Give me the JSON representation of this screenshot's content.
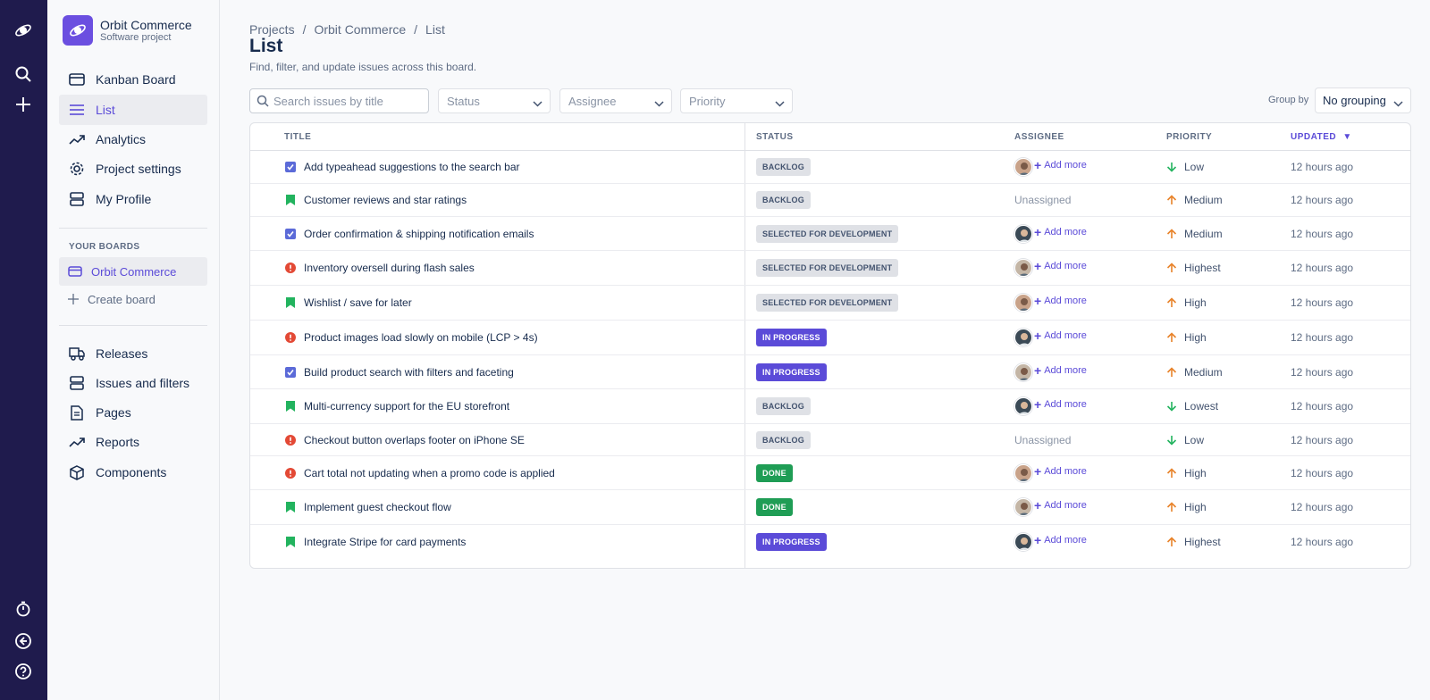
{
  "colors": {
    "rail": "#1f1b4d",
    "accent": "#5b4bd8",
    "done": "#1f9d55",
    "bug": "#e34935",
    "story": "#22b35e",
    "task": "#5b6ad8",
    "priority_up": "#e8832a",
    "priority_down": "#22b35e"
  },
  "rail": {
    "icons": [
      "orbit-logo-icon",
      "search-icon",
      "plus-icon",
      "timer-icon",
      "back-icon",
      "help-icon"
    ]
  },
  "project": {
    "name": "Orbit Commerce",
    "type": "Software project"
  },
  "sidebar": {
    "nav": [
      {
        "label": "Kanban Board",
        "icon": "board-icon"
      },
      {
        "label": "List",
        "icon": "list-icon"
      },
      {
        "label": "Analytics",
        "icon": "trend-icon"
      },
      {
        "label": "Project settings",
        "icon": "gear-icon"
      },
      {
        "label": "My Profile",
        "icon": "profile-icon"
      }
    ],
    "boards_label": "YOUR BOARDS",
    "board": "Orbit Commerce",
    "create_board": "Create board",
    "nav2": [
      {
        "label": "Releases",
        "icon": "truck-icon"
      },
      {
        "label": "Issues and filters",
        "icon": "filter-icon"
      },
      {
        "label": "Pages",
        "icon": "page-icon"
      },
      {
        "label": "Reports",
        "icon": "reports-icon"
      },
      {
        "label": "Components",
        "icon": "component-icon"
      }
    ]
  },
  "breadcrumb": [
    "Projects",
    "Orbit Commerce",
    "List"
  ],
  "page": {
    "title": "List",
    "subtitle": "Find, filter, and update issues across this board."
  },
  "filters": {
    "search_placeholder": "Search issues by title",
    "status": "Status",
    "assignee": "Assignee",
    "priority": "Priority",
    "group_by_label": "Group by",
    "group_by_value": "No grouping"
  },
  "table": {
    "headers": {
      "title": "TITLE",
      "status": "STATUS",
      "assignee": "ASSIGNEE",
      "priority": "PRIORITY",
      "updated": "UPDATED"
    },
    "sort_indicator": "▼",
    "add_more": "Add more",
    "rows": [
      {
        "type": "task",
        "title": "Add typeahead suggestions to the search bar",
        "status": "BACKLOG",
        "status_style": "gray",
        "assignee": "avatar",
        "avatar_variant": "a",
        "priority": "Low",
        "priority_dir": "down",
        "updated": "12 hours ago"
      },
      {
        "type": "story",
        "title": "Customer reviews and star ratings",
        "status": "BACKLOG",
        "status_style": "gray",
        "assignee": "none",
        "unassigned": "Unassigned",
        "priority": "Medium",
        "priority_dir": "up",
        "updated": "12 hours ago"
      },
      {
        "type": "task",
        "title": "Order confirmation & shipping notification emails",
        "status": "SELECTED FOR DEVELOPMENT",
        "status_style": "gray",
        "assignee": "avatar",
        "avatar_variant": "b",
        "priority": "Medium",
        "priority_dir": "up",
        "updated": "12 hours ago"
      },
      {
        "type": "bug",
        "title": "Inventory oversell during flash sales",
        "status": "SELECTED FOR DEVELOPMENT",
        "status_style": "gray",
        "assignee": "avatar",
        "avatar_variant": "c",
        "priority": "Highest",
        "priority_dir": "up",
        "updated": "12 hours ago"
      },
      {
        "type": "story",
        "title": "Wishlist / save for later",
        "status": "SELECTED FOR DEVELOPMENT",
        "status_style": "gray",
        "assignee": "avatar",
        "avatar_variant": "a",
        "priority": "High",
        "priority_dir": "up",
        "updated": "12 hours ago"
      },
      {
        "type": "bug",
        "title": "Product images load slowly on mobile (LCP > 4s)",
        "status": "IN PROGRESS",
        "status_style": "blue",
        "assignee": "avatar",
        "avatar_variant": "b",
        "priority": "High",
        "priority_dir": "up",
        "updated": "12 hours ago"
      },
      {
        "type": "task",
        "title": "Build product search with filters and faceting",
        "status": "IN PROGRESS",
        "status_style": "blue",
        "assignee": "avatar",
        "avatar_variant": "c",
        "priority": "Medium",
        "priority_dir": "up",
        "updated": "12 hours ago"
      },
      {
        "type": "story",
        "title": "Multi-currency support for the EU storefront",
        "status": "BACKLOG",
        "status_style": "gray",
        "assignee": "avatar",
        "avatar_variant": "b",
        "priority": "Lowest",
        "priority_dir": "down",
        "updated": "12 hours ago"
      },
      {
        "type": "bug",
        "title": "Checkout button overlaps footer on iPhone SE",
        "status": "BACKLOG",
        "status_style": "gray",
        "assignee": "none",
        "unassigned": "Unassigned",
        "priority": "Low",
        "priority_dir": "down",
        "updated": "12 hours ago"
      },
      {
        "type": "bug",
        "title": "Cart total not updating when a promo code is applied",
        "status": "DONE",
        "status_style": "green",
        "assignee": "avatar",
        "avatar_variant": "a",
        "priority": "High",
        "priority_dir": "up",
        "updated": "12 hours ago"
      },
      {
        "type": "story",
        "title": "Implement guest checkout flow",
        "status": "DONE",
        "status_style": "green",
        "assignee": "avatar",
        "avatar_variant": "c",
        "priority": "High",
        "priority_dir": "up",
        "updated": "12 hours ago"
      },
      {
        "type": "story",
        "title": "Integrate Stripe for card payments",
        "status": "IN PROGRESS",
        "status_style": "blue",
        "assignee": "avatar",
        "avatar_variant": "b",
        "priority": "Highest",
        "priority_dir": "up",
        "updated": "12 hours ago"
      }
    ]
  }
}
